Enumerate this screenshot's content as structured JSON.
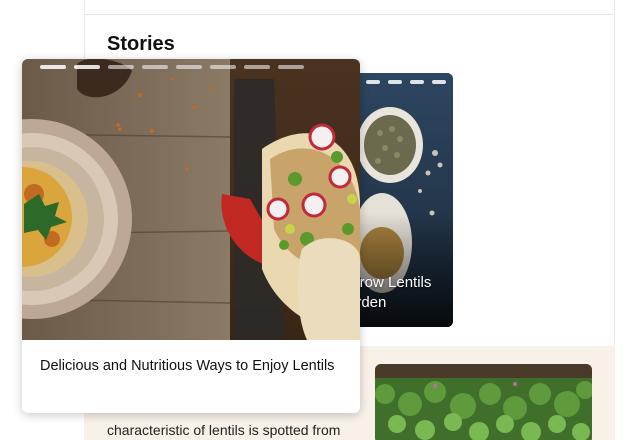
{
  "section": {
    "title": "Stories"
  },
  "stories": [
    {
      "title": "Delicious and Nutritious Ways to Enjoy Lentils",
      "segments_total": 8,
      "segments_active": 2
    },
    {
      "title": "Grow Lentils\nGarden",
      "visible_title": [
        "Grow Lentils",
        "arden"
      ],
      "segments_total": 4
    }
  ],
  "article": {
    "excerpt": "characteristic of lentils is spotted from"
  },
  "colors": {
    "card_bg": "#ffffff",
    "beige": "#f7f1e8",
    "story_back_bg": "#2b3a4c"
  }
}
